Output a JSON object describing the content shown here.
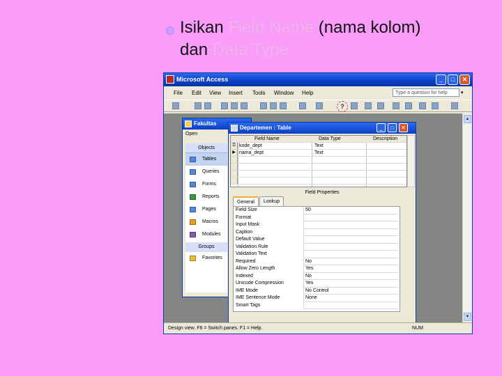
{
  "slide": {
    "line1_plain": "Isikan ",
    "line1_ghost": "Field Name",
    "line1_end": " (nama kolom)",
    "line2_plain": "dan ",
    "line2_ghost": "Data Type"
  },
  "app": {
    "title": "Microsoft Access",
    "menu": [
      "File",
      "Edit",
      "View",
      "Insert",
      "Tools",
      "Window",
      "Help"
    ],
    "help_placeholder": "Type a question for help",
    "status_left": "Design view.  F6 = Switch panes.  F1 = Help.",
    "status_right": "NUM"
  },
  "db_window": {
    "title": "Fakultas",
    "toolbar_label": "Open",
    "objects_header": "Objects",
    "items": [
      "Tables",
      "Queries",
      "Forms",
      "Reports",
      "Pages",
      "Macros",
      "Modules"
    ],
    "groups_header": "Groups",
    "favorites": "Favorites"
  },
  "table_window": {
    "title": "Departemen : Table",
    "columns": [
      "Field Name",
      "Data Type",
      "Description"
    ],
    "rows": [
      {
        "marker": "⚿",
        "field": "kode_dept",
        "type": "Text"
      },
      {
        "marker": "▶",
        "field": "nama_dept",
        "type": "Text"
      }
    ],
    "field_properties_label": "Field Properties",
    "tabs": [
      "General",
      "Lookup"
    ],
    "properties": [
      {
        "label": "Field Size",
        "value": "50"
      },
      {
        "label": "Format",
        "value": ""
      },
      {
        "label": "Input Mask",
        "value": ""
      },
      {
        "label": "Caption",
        "value": ""
      },
      {
        "label": "Default Value",
        "value": ""
      },
      {
        "label": "Validation Rule",
        "value": ""
      },
      {
        "label": "Validation Text",
        "value": ""
      },
      {
        "label": "Required",
        "value": "No"
      },
      {
        "label": "Allow Zero Length",
        "value": "Yes"
      },
      {
        "label": "Indexed",
        "value": "No"
      },
      {
        "label": "Unicode Compression",
        "value": "Yes"
      },
      {
        "label": "IME Mode",
        "value": "No Control"
      },
      {
        "label": "IME Sentence Mode",
        "value": "None"
      },
      {
        "label": "Smart Tags",
        "value": ""
      }
    ]
  }
}
